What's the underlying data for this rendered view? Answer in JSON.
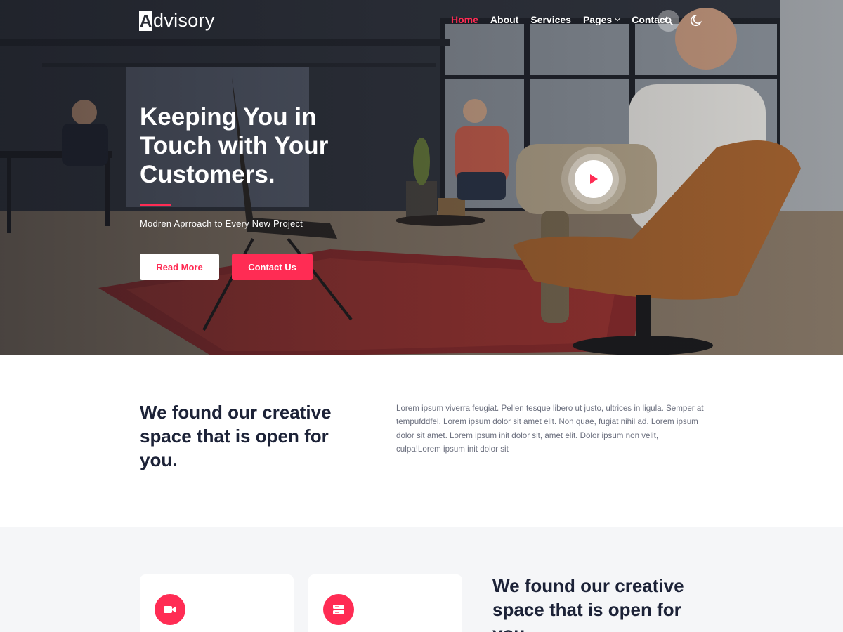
{
  "brand": {
    "logo_letter": "A",
    "logo_rest": "dvisory",
    "accent_color": "#ff2c54"
  },
  "nav": {
    "items": [
      {
        "label": "Home",
        "active": true
      },
      {
        "label": "About",
        "active": false
      },
      {
        "label": "Services",
        "active": false
      },
      {
        "label": "Pages",
        "active": false
      },
      {
        "label": "Contact",
        "active": false
      }
    ],
    "search_icon": "search-icon",
    "theme_icon": "moon-icon"
  },
  "hero": {
    "title": "Keeping You in Touch with Your Customers.",
    "subtitle": "Modren Aprroach to Every New Project",
    "read_more_label": "Read More",
    "contact_label": "Contact Us",
    "play_icon": "play-icon"
  },
  "about": {
    "title": "We found our creative space that is open for you.",
    "text": "Lorem ipsum viverra feugiat. Pellen tesque libero ut justo, ultrices in ligula. Semper at tempufddfel. Lorem ipsum dolor sit amet elit. Non quae, fugiat nihil ad. Lorem ipsum dolor sit amet. Lorem ipsum init dolor sit, amet elit. Dolor ipsum non velit, culpa!Lorem ipsum init dolor sit"
  },
  "features": {
    "title": "We found our creative space that is open for you.",
    "cards": [
      {
        "icon": "video-camera-icon"
      },
      {
        "icon": "server-icon"
      }
    ]
  }
}
